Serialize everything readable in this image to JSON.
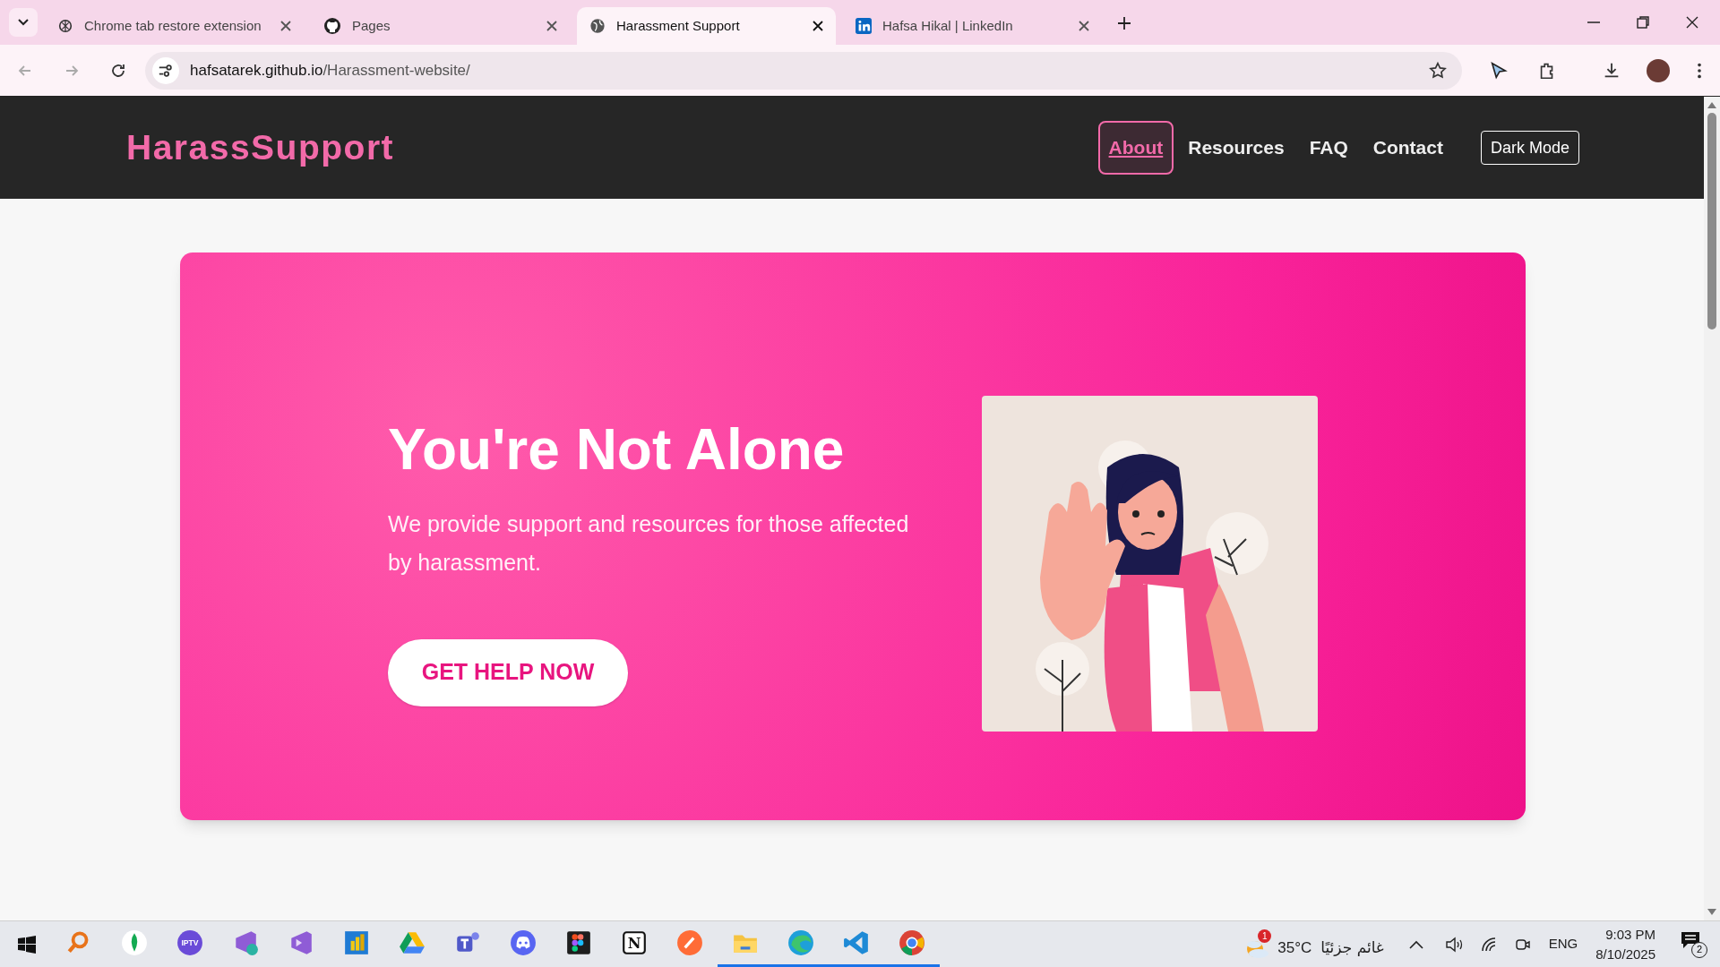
{
  "browser": {
    "tabs": [
      {
        "title": "Chrome tab restore extension",
        "kind": "openai",
        "selected": false
      },
      {
        "title": "Pages",
        "kind": "github",
        "selected": false
      },
      {
        "title": "Harassment Support",
        "kind": "globe",
        "selected": true
      },
      {
        "title": "Hafsa Hikal | LinkedIn",
        "kind": "linkedin",
        "selected": false
      }
    ],
    "address": {
      "host": "hafsatarek.github.io",
      "path": "/Harassment-website/"
    }
  },
  "site": {
    "logo": "HarassSupport",
    "nav": [
      {
        "label": "About",
        "selected": true
      },
      {
        "label": "Resources",
        "selected": false
      },
      {
        "label": "FAQ",
        "selected": false
      },
      {
        "label": "Contact",
        "selected": false
      }
    ],
    "theme_button": "Dark Mode",
    "hero": {
      "title": "You're Not Alone",
      "text": "We provide support and resources for those affected by harassment.",
      "button": "GET HELP NOW"
    }
  },
  "taskbar": {
    "apps": [
      {
        "kind": "search",
        "running": false
      },
      {
        "kind": "leaf",
        "running": false
      },
      {
        "kind": "iptv",
        "label": "IPTV",
        "running": false
      },
      {
        "kind": "vs-installer",
        "running": false
      },
      {
        "kind": "vs",
        "running": false
      },
      {
        "kind": "powerbi",
        "running": false
      },
      {
        "kind": "drive",
        "running": false
      },
      {
        "kind": "teams",
        "running": false
      },
      {
        "kind": "discord",
        "running": false
      },
      {
        "kind": "figma",
        "running": false
      },
      {
        "kind": "notion",
        "label": "N",
        "running": false
      },
      {
        "kind": "postman",
        "running": false
      },
      {
        "kind": "folder",
        "running": true
      },
      {
        "kind": "edge",
        "running": true
      },
      {
        "kind": "vscode",
        "running": true
      },
      {
        "kind": "chrome",
        "running": true
      }
    ],
    "weather": {
      "badge": "1",
      "temperature": "35°C",
      "condition": "غائم جزئيًا"
    },
    "language": "ENG",
    "time": "9:03 PM",
    "date": "8/10/2025",
    "notifications": "2"
  }
}
